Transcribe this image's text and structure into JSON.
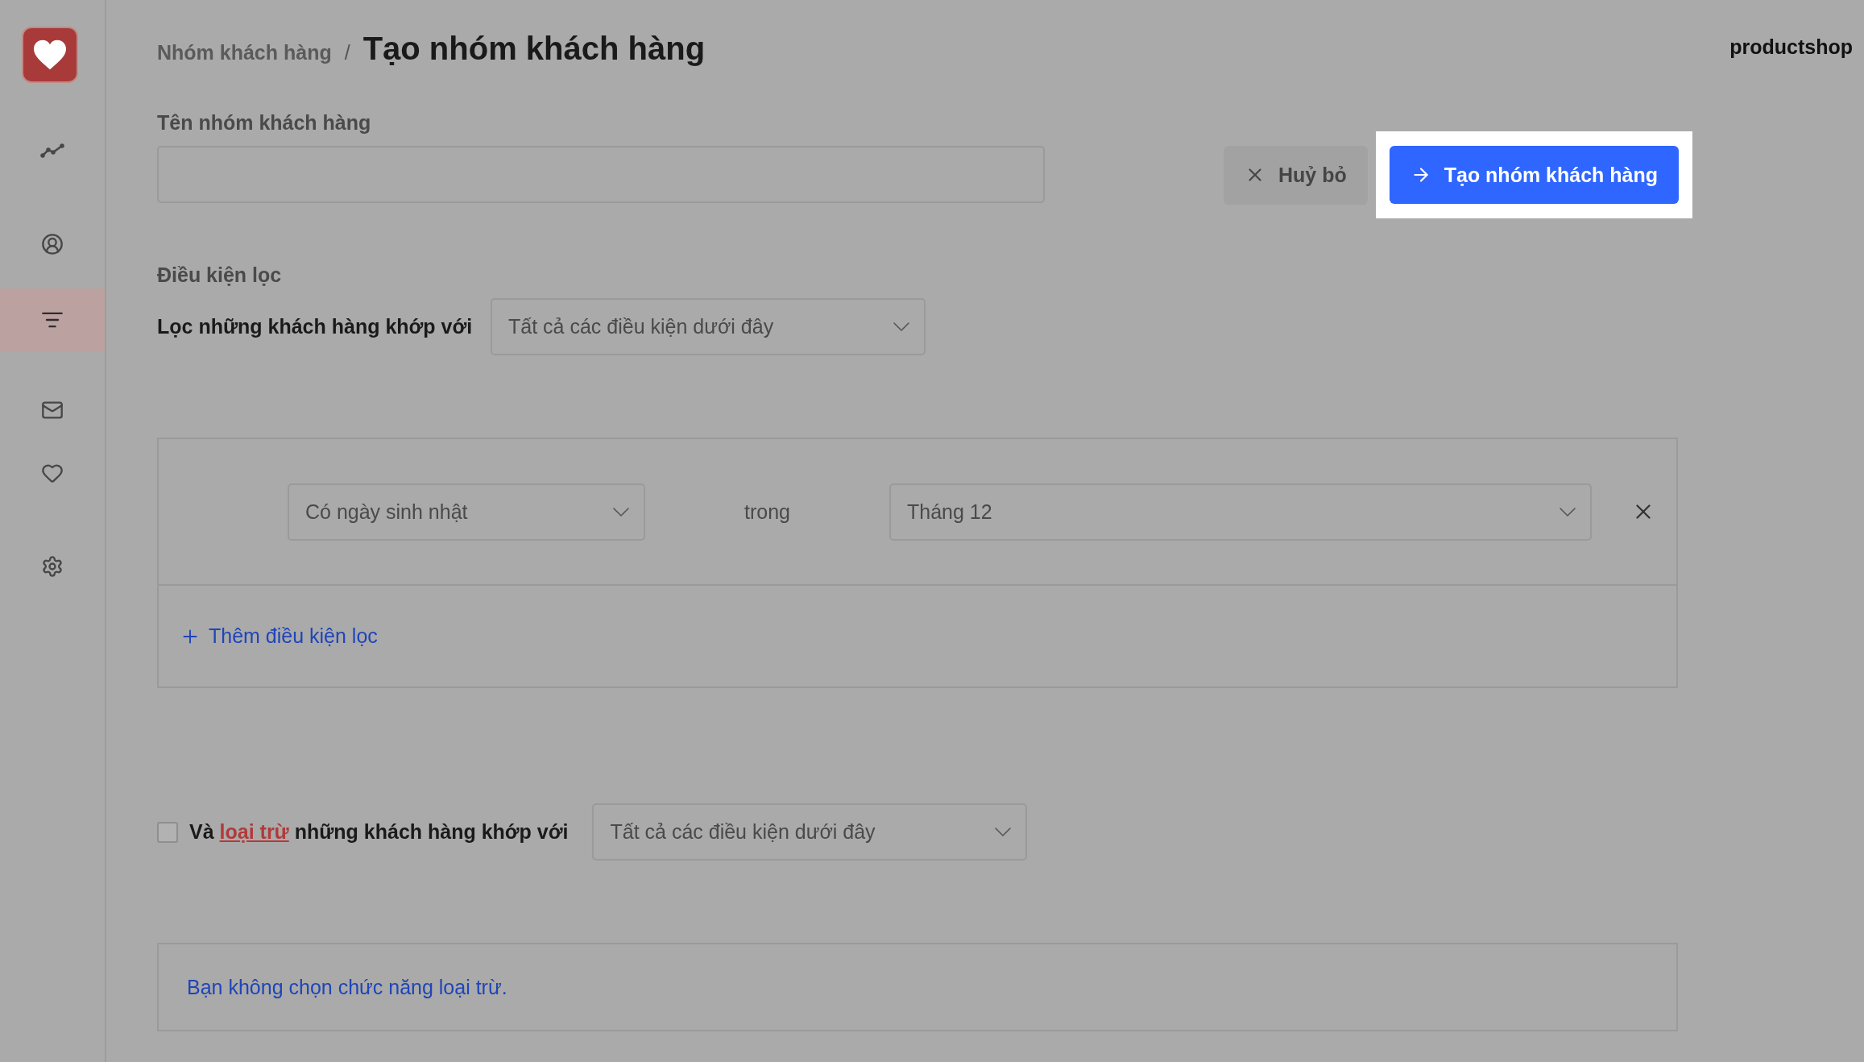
{
  "sidebar": {
    "items": [
      {
        "kind": "chart",
        "selected": false
      },
      {
        "kind": "user",
        "selected": false
      },
      {
        "kind": "filter",
        "selected": true
      },
      {
        "kind": "mail",
        "selected": false
      },
      {
        "kind": "heart",
        "selected": false
      },
      {
        "kind": "settings",
        "selected": false
      }
    ]
  },
  "breadcrumb": {
    "parent": "Nhóm khách hàng",
    "separator": "/",
    "title": "Tạo nhóm khách hàng"
  },
  "account": "productshop",
  "name_field": {
    "label": "Tên nhóm khách hàng"
  },
  "buttons": {
    "cancel": "Huỷ bỏ",
    "create": {
      "label": "Tạo nhóm khách hàng",
      "highlighted": true
    }
  },
  "filter": {
    "section_title": "Điều kiện lọc",
    "match_label": "Lọc những khách hàng khớp với",
    "match_value": "Tất cả các điều kiện dưới đây",
    "conditions": [
      {
        "field": "Có ngày sinh nhật",
        "operator": "trong",
        "value": "Tháng 12"
      }
    ],
    "add_label": "Thêm điều kiện lọc"
  },
  "exclude": {
    "checked": false,
    "prefix": "Và",
    "link": "loại trừ",
    "suffix": "những khách hàng khớp với",
    "match_value": "Tất cả các điều kiện dưới đây",
    "notice": "Bạn không chọn chức năng loại trừ."
  }
}
